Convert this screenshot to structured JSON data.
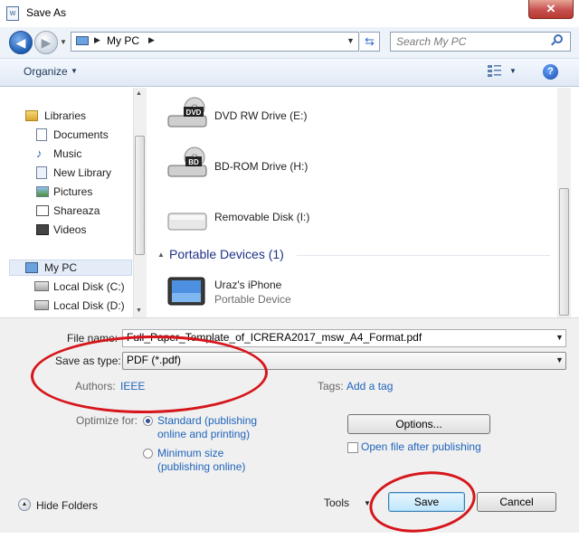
{
  "window": {
    "title": "Save As",
    "app_icon": "word-doc-icon",
    "close_label": "✕"
  },
  "navigation": {
    "back_icon": "back-arrow-icon",
    "forward_icon": "forward-arrow-icon",
    "address_path": "My PC",
    "search_placeholder": "Search My PC"
  },
  "toolbar": {
    "organize_label": "Organize",
    "help_label": "?"
  },
  "sidebar": {
    "items": [
      {
        "label": "Libraries",
        "icon": "libraries-icon"
      },
      {
        "label": "Documents",
        "icon": "documents-icon"
      },
      {
        "label": "Music",
        "icon": "music-icon"
      },
      {
        "label": "New Library",
        "icon": "library-icon"
      },
      {
        "label": "Pictures",
        "icon": "pictures-icon"
      },
      {
        "label": "Shareaza",
        "icon": "shareaza-icon"
      },
      {
        "label": "Videos",
        "icon": "videos-icon"
      },
      {
        "label": "My PC",
        "icon": "computer-icon"
      },
      {
        "label": "Local Disk (C:)",
        "icon": "local-disk-icon"
      },
      {
        "label": "Local Disk (D:)",
        "icon": "local-disk-icon"
      }
    ]
  },
  "main": {
    "drives": [
      {
        "label": "DVD RW Drive (E:)",
        "badge": "DVD",
        "icon": "dvd-drive-icon"
      },
      {
        "label": "BD-ROM Drive (H:)",
        "badge": "BD",
        "icon": "bd-drive-icon"
      },
      {
        "label": "Removable Disk (I:)",
        "icon": "removable-disk-icon"
      }
    ],
    "group_header": "Portable Devices (1)",
    "device": {
      "name": "Uraz's iPhone",
      "subtitle": "Portable Device",
      "icon": "portable-device-icon"
    }
  },
  "form": {
    "file_name_label": "File name:",
    "file_name_value": "Full_Paper_Template_of_ICRERA2017_msw_A4_Format.pdf",
    "save_as_type_label": "Save as type:",
    "save_as_type_value": "PDF (*.pdf)",
    "authors_label": "Authors:",
    "authors_value": "IEEE",
    "tags_label": "Tags:",
    "tags_value": "Add a tag",
    "optimize_label": "Optimize for:",
    "optimize_standard_line1": "Standard (publishing",
    "optimize_standard_line2": "online and printing)",
    "optimize_minimum_line1": "Minimum size",
    "optimize_minimum_line2": "(publishing online)",
    "options_button": "Options...",
    "open_after_label": "Open file after publishing",
    "hide_folders_label": "Hide Folders",
    "tools_label": "Tools",
    "save_button": "Save",
    "cancel_button": "Cancel"
  },
  "colors": {
    "annotation_red": "#d6161b",
    "link_blue": "#1f64bb"
  }
}
